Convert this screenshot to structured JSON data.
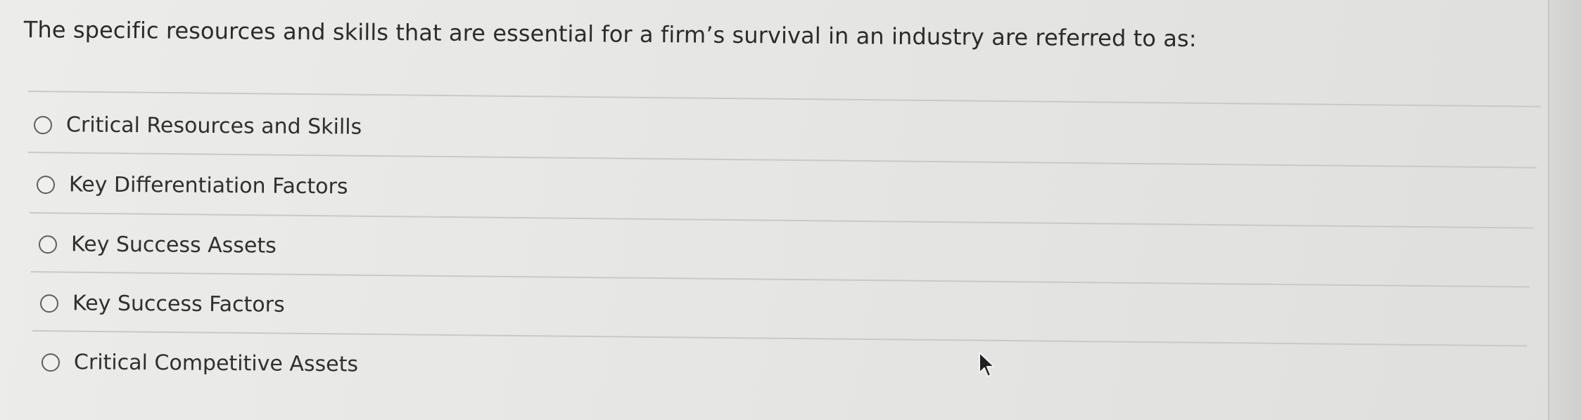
{
  "question": {
    "text": "The specific resources and skills that are essential for a firm’s survival in an industry are referred to as:"
  },
  "options": [
    {
      "label": "Critical Resources and Skills",
      "selected": false
    },
    {
      "label": "Key Differentiation Factors",
      "selected": false
    },
    {
      "label": "Key Success Assets",
      "selected": false
    },
    {
      "label": "Key Success Factors",
      "selected": false
    },
    {
      "label": "Critical Competitive Assets",
      "selected": false
    }
  ],
  "icons": {
    "radio": "radio-button-icon",
    "cursor": "mouse-pointer-icon"
  }
}
